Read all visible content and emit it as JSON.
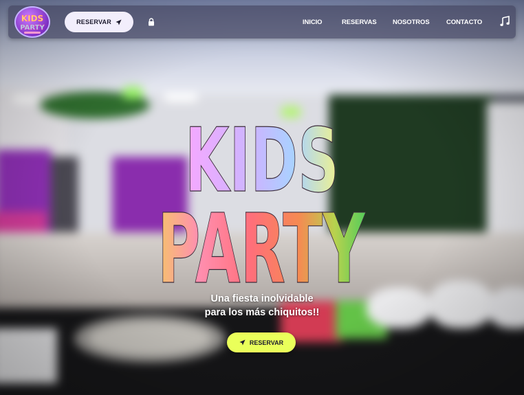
{
  "navbar": {
    "logo_text": "KIDS PARTY",
    "reserve_button_label": "RESERVAR",
    "links": [
      {
        "label": "INICIO"
      },
      {
        "label": "RESERVAS"
      },
      {
        "label": "NOSOTROS"
      },
      {
        "label": "CONTACTO"
      }
    ],
    "icons": {
      "reserve": "send-arrow-icon",
      "lock": "lock-icon",
      "music": "music-note-icon"
    }
  },
  "hero": {
    "title_line_1": "KIDS",
    "title_line_2": "PARTY",
    "tagline_line_1": "Una fiesta inolvidable",
    "tagline_line_2": "para los más chiquitos!!",
    "cta_label": "RESERVAR"
  },
  "colors": {
    "navbar_bg": "#464864",
    "nav_button_bg": "#f2eefc",
    "cta_bg": "#eaff5a",
    "title_gradient_kids": [
      "#f6a8ff",
      "#b7c7ff",
      "#e9f39a"
    ],
    "title_gradient_party": [
      "#f6b86a",
      "#ff7a8c",
      "#ff6f6f",
      "#f5a04e",
      "#63d05a"
    ]
  }
}
